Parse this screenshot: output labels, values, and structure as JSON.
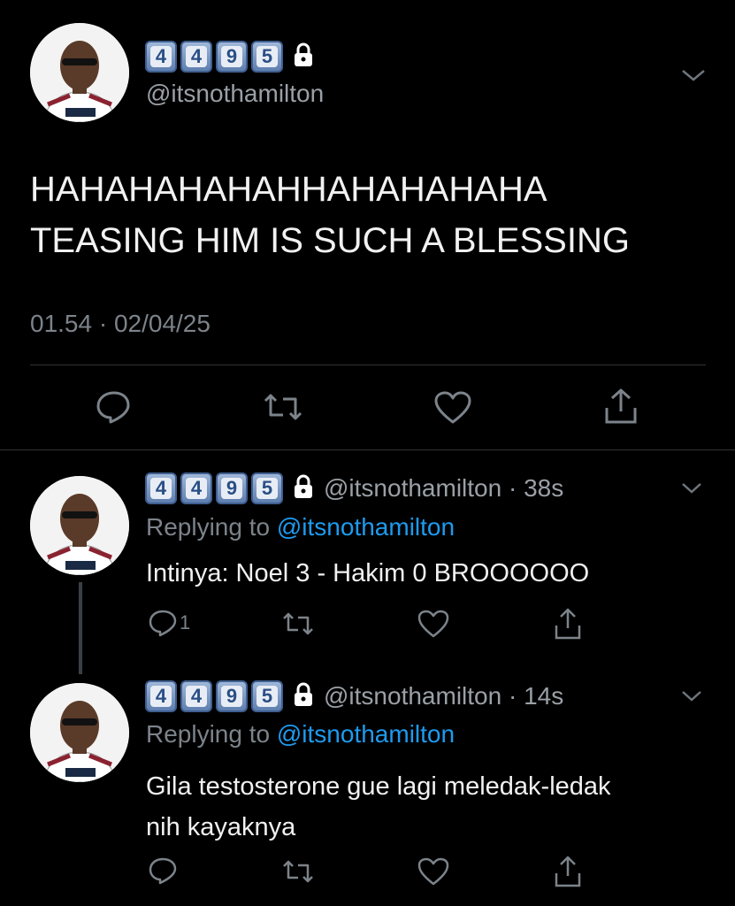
{
  "main_tweet": {
    "name_keycaps": [
      "4",
      "4",
      "9",
      "5"
    ],
    "handle": "@itsnothamilton",
    "text_line1": "HAHAHAHAHAHHAHAHAHAHA",
    "text_line2": "TEASING HIM IS SUCH A BLESSING",
    "timestamp": "01.54 · 02/04/25"
  },
  "replies": [
    {
      "name_keycaps": [
        "4",
        "4",
        "9",
        "5"
      ],
      "handle_time": "@itsnothamilton · 38s",
      "replying_prefix": "Replying to",
      "replying_handle": "@itsnothamilton",
      "text": "Intinya: Noel 3 - Hakim 0 BROOOOOO",
      "reply_count": "1"
    },
    {
      "name_keycaps": [
        "4",
        "4",
        "9",
        "5"
      ],
      "handle_time": "@itsnothamilton · 14s",
      "replying_prefix": "Replying to",
      "replying_handle": "@itsnothamilton",
      "text_line1": "Gila testosterone gue lagi meledak-ledak",
      "text_line2": "nih kayaknya",
      "reply_count": ""
    }
  ],
  "icons": {
    "reply": "reply-icon",
    "retweet": "retweet-icon",
    "like": "heart-icon",
    "share": "share-icon",
    "menu": "chevron-down-icon",
    "lock": "lock-icon"
  },
  "colors": {
    "background": "#000000",
    "text": "#e7e9ea",
    "muted": "#7c838a",
    "link": "#1d9bf0"
  }
}
